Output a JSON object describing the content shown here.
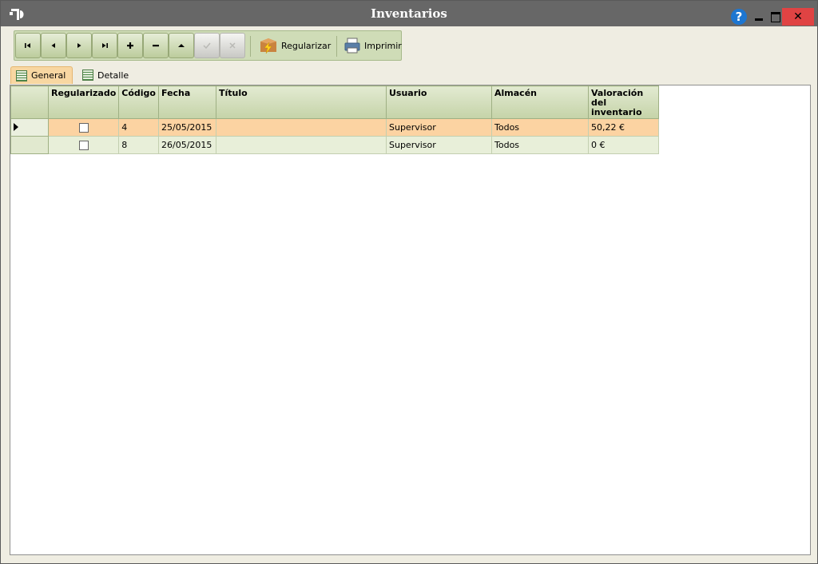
{
  "window": {
    "title": "Inventarios"
  },
  "toolbar": {
    "regularizar_label": "Regularizar",
    "imprimir_label": "Imprimir"
  },
  "tabs": [
    {
      "label": "General"
    },
    {
      "label": "Detalle"
    }
  ],
  "table": {
    "columns": [
      "Regularizado",
      "Código",
      "Fecha",
      "Título",
      "Usuario",
      "Almacén",
      "Valoración del inventario"
    ],
    "rows": [
      {
        "regularizado": false,
        "codigo": "4",
        "fecha": "25/05/2015",
        "titulo": "",
        "usuario": "Supervisor",
        "almacen": "Todos",
        "valoracion": "50,22 €"
      },
      {
        "regularizado": false,
        "codigo": "8",
        "fecha": "26/05/2015",
        "titulo": "",
        "usuario": "Supervisor",
        "almacen": "Todos",
        "valoracion": "0 €"
      }
    ]
  },
  "colors": {
    "selected_row": "#fcd3a2",
    "alt_row": "#e8efd9",
    "close": "#e04343",
    "help": "#1d76d1"
  }
}
